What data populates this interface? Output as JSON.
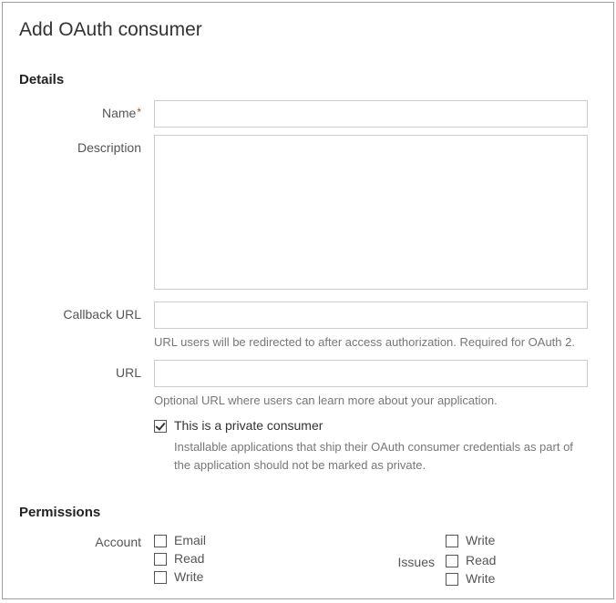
{
  "page_title": "Add OAuth consumer",
  "sections": {
    "details": {
      "title": "Details",
      "fields": {
        "name": {
          "label": "Name",
          "required": true,
          "value": ""
        },
        "description": {
          "label": "Description",
          "value": ""
        },
        "callback_url": {
          "label": "Callback URL",
          "value": "",
          "help": "URL users will be redirected to after access authorization. Required for OAuth 2."
        },
        "url": {
          "label": "URL",
          "value": "",
          "help": "Optional URL where users can learn more about your application."
        },
        "private_consumer": {
          "checked": true,
          "label": "This is a private consumer",
          "help": "Installable applications that ship their OAuth consumer credentials as part of the application should not be marked as private."
        }
      }
    },
    "permissions": {
      "title": "Permissions",
      "groups": {
        "account": {
          "label": "Account",
          "options": [
            {
              "label": "Email",
              "checked": false
            },
            {
              "label": "Read",
              "checked": false
            },
            {
              "label": "Write",
              "checked": false
            }
          ],
          "right_options": [
            {
              "label": "Write",
              "checked": false
            }
          ]
        },
        "issues": {
          "label": "Issues",
          "options": [
            {
              "label": "Read",
              "checked": false
            },
            {
              "label": "Write",
              "checked": false
            }
          ]
        }
      }
    }
  }
}
